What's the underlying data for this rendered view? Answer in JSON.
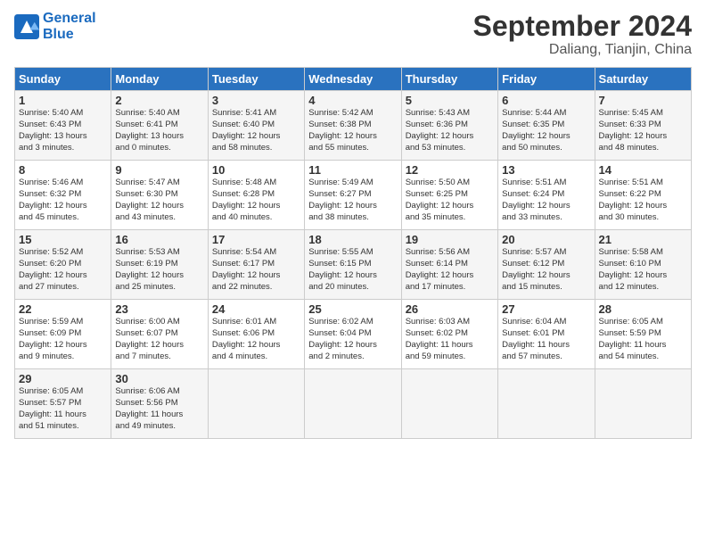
{
  "header": {
    "logo_line1": "General",
    "logo_line2": "Blue",
    "month_year": "September 2024",
    "location": "Daliang, Tianjin, China"
  },
  "days_of_week": [
    "Sunday",
    "Monday",
    "Tuesday",
    "Wednesday",
    "Thursday",
    "Friday",
    "Saturday"
  ],
  "weeks": [
    [
      {
        "num": "1",
        "info": "Sunrise: 5:40 AM\nSunset: 6:43 PM\nDaylight: 13 hours\nand 3 minutes."
      },
      {
        "num": "2",
        "info": "Sunrise: 5:40 AM\nSunset: 6:41 PM\nDaylight: 13 hours\nand 0 minutes."
      },
      {
        "num": "3",
        "info": "Sunrise: 5:41 AM\nSunset: 6:40 PM\nDaylight: 12 hours\nand 58 minutes."
      },
      {
        "num": "4",
        "info": "Sunrise: 5:42 AM\nSunset: 6:38 PM\nDaylight: 12 hours\nand 55 minutes."
      },
      {
        "num": "5",
        "info": "Sunrise: 5:43 AM\nSunset: 6:36 PM\nDaylight: 12 hours\nand 53 minutes."
      },
      {
        "num": "6",
        "info": "Sunrise: 5:44 AM\nSunset: 6:35 PM\nDaylight: 12 hours\nand 50 minutes."
      },
      {
        "num": "7",
        "info": "Sunrise: 5:45 AM\nSunset: 6:33 PM\nDaylight: 12 hours\nand 48 minutes."
      }
    ],
    [
      {
        "num": "8",
        "info": "Sunrise: 5:46 AM\nSunset: 6:32 PM\nDaylight: 12 hours\nand 45 minutes."
      },
      {
        "num": "9",
        "info": "Sunrise: 5:47 AM\nSunset: 6:30 PM\nDaylight: 12 hours\nand 43 minutes."
      },
      {
        "num": "10",
        "info": "Sunrise: 5:48 AM\nSunset: 6:28 PM\nDaylight: 12 hours\nand 40 minutes."
      },
      {
        "num": "11",
        "info": "Sunrise: 5:49 AM\nSunset: 6:27 PM\nDaylight: 12 hours\nand 38 minutes."
      },
      {
        "num": "12",
        "info": "Sunrise: 5:50 AM\nSunset: 6:25 PM\nDaylight: 12 hours\nand 35 minutes."
      },
      {
        "num": "13",
        "info": "Sunrise: 5:51 AM\nSunset: 6:24 PM\nDaylight: 12 hours\nand 33 minutes."
      },
      {
        "num": "14",
        "info": "Sunrise: 5:51 AM\nSunset: 6:22 PM\nDaylight: 12 hours\nand 30 minutes."
      }
    ],
    [
      {
        "num": "15",
        "info": "Sunrise: 5:52 AM\nSunset: 6:20 PM\nDaylight: 12 hours\nand 27 minutes."
      },
      {
        "num": "16",
        "info": "Sunrise: 5:53 AM\nSunset: 6:19 PM\nDaylight: 12 hours\nand 25 minutes."
      },
      {
        "num": "17",
        "info": "Sunrise: 5:54 AM\nSunset: 6:17 PM\nDaylight: 12 hours\nand 22 minutes."
      },
      {
        "num": "18",
        "info": "Sunrise: 5:55 AM\nSunset: 6:15 PM\nDaylight: 12 hours\nand 20 minutes."
      },
      {
        "num": "19",
        "info": "Sunrise: 5:56 AM\nSunset: 6:14 PM\nDaylight: 12 hours\nand 17 minutes."
      },
      {
        "num": "20",
        "info": "Sunrise: 5:57 AM\nSunset: 6:12 PM\nDaylight: 12 hours\nand 15 minutes."
      },
      {
        "num": "21",
        "info": "Sunrise: 5:58 AM\nSunset: 6:10 PM\nDaylight: 12 hours\nand 12 minutes."
      }
    ],
    [
      {
        "num": "22",
        "info": "Sunrise: 5:59 AM\nSunset: 6:09 PM\nDaylight: 12 hours\nand 9 minutes."
      },
      {
        "num": "23",
        "info": "Sunrise: 6:00 AM\nSunset: 6:07 PM\nDaylight: 12 hours\nand 7 minutes."
      },
      {
        "num": "24",
        "info": "Sunrise: 6:01 AM\nSunset: 6:06 PM\nDaylight: 12 hours\nand 4 minutes."
      },
      {
        "num": "25",
        "info": "Sunrise: 6:02 AM\nSunset: 6:04 PM\nDaylight: 12 hours\nand 2 minutes."
      },
      {
        "num": "26",
        "info": "Sunrise: 6:03 AM\nSunset: 6:02 PM\nDaylight: 11 hours\nand 59 minutes."
      },
      {
        "num": "27",
        "info": "Sunrise: 6:04 AM\nSunset: 6:01 PM\nDaylight: 11 hours\nand 57 minutes."
      },
      {
        "num": "28",
        "info": "Sunrise: 6:05 AM\nSunset: 5:59 PM\nDaylight: 11 hours\nand 54 minutes."
      }
    ],
    [
      {
        "num": "29",
        "info": "Sunrise: 6:05 AM\nSunset: 5:57 PM\nDaylight: 11 hours\nand 51 minutes."
      },
      {
        "num": "30",
        "info": "Sunrise: 6:06 AM\nSunset: 5:56 PM\nDaylight: 11 hours\nand 49 minutes."
      },
      {
        "num": "",
        "info": ""
      },
      {
        "num": "",
        "info": ""
      },
      {
        "num": "",
        "info": ""
      },
      {
        "num": "",
        "info": ""
      },
      {
        "num": "",
        "info": ""
      }
    ]
  ]
}
